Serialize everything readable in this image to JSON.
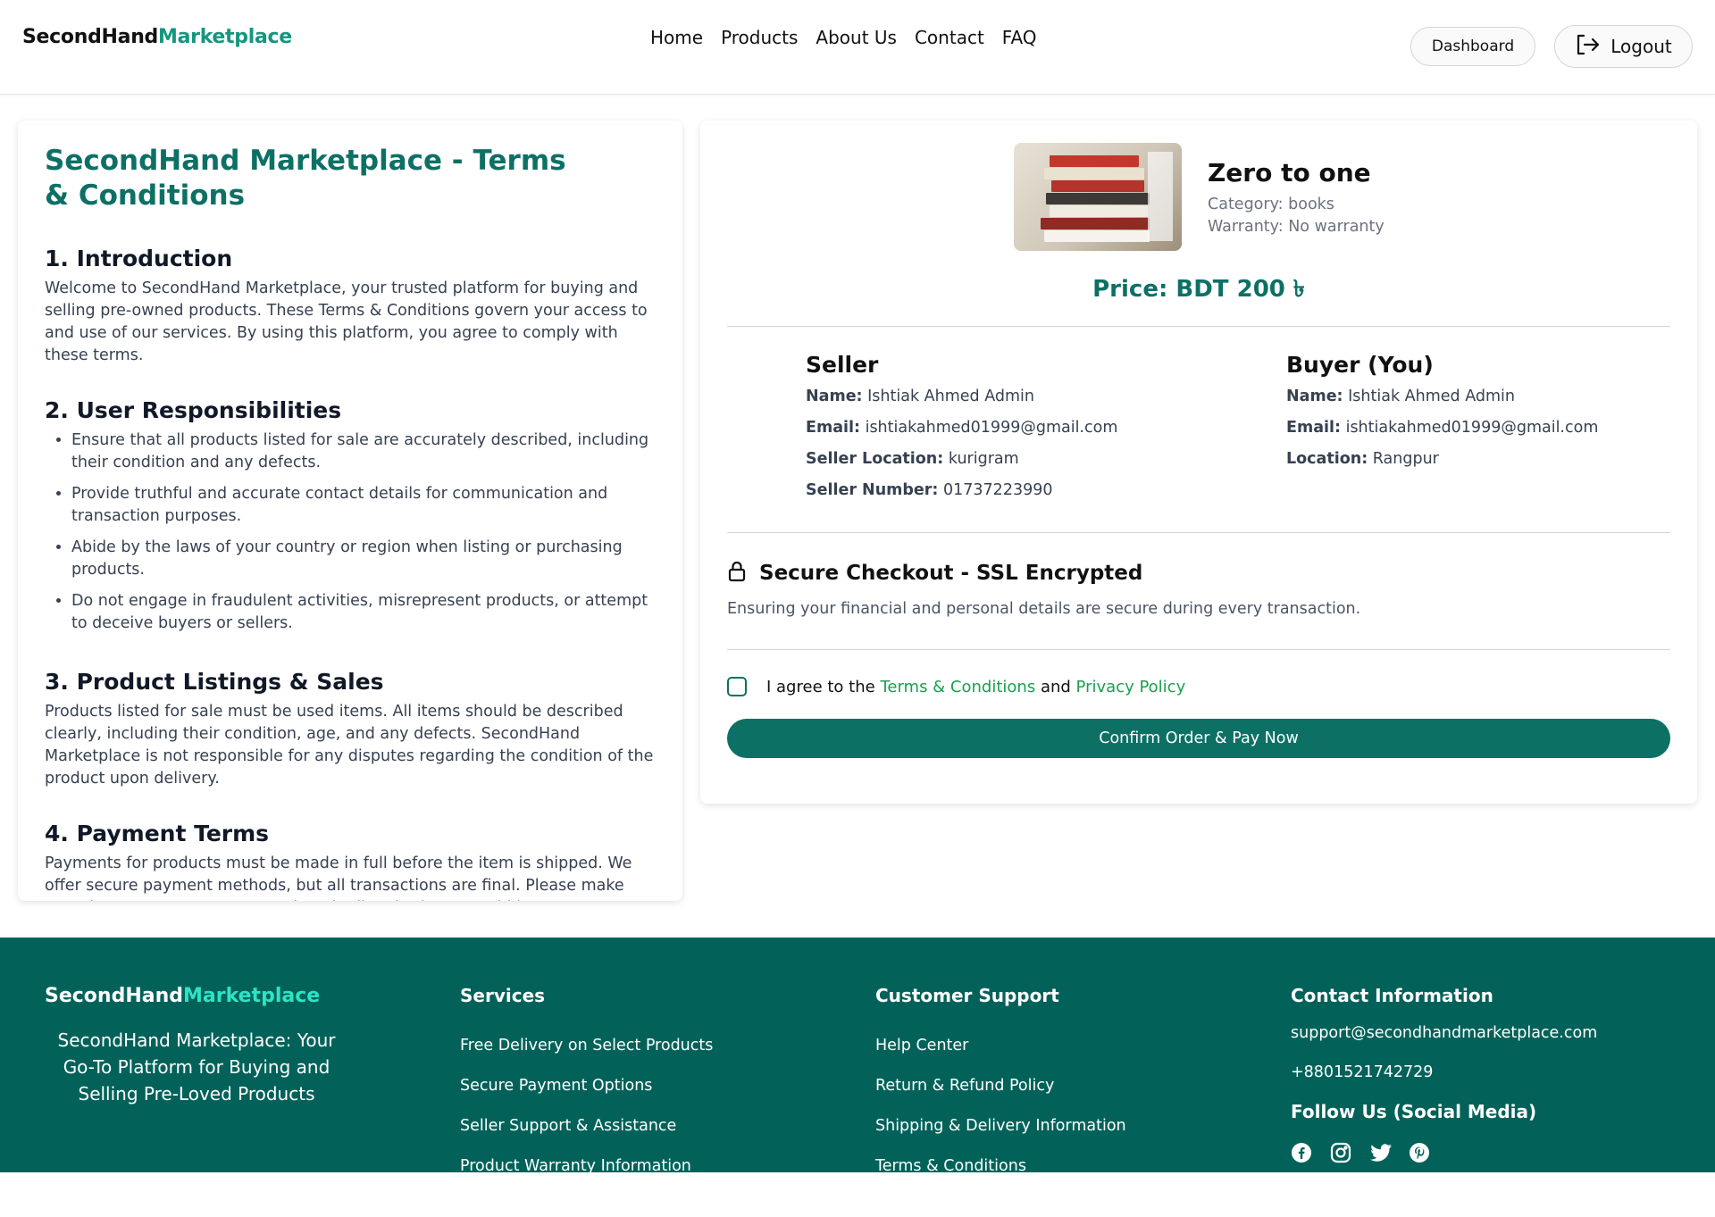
{
  "header": {
    "logo_main": "SecondHand",
    "logo_accent": "Marketplace",
    "nav": [
      "Home",
      "Products",
      "About Us",
      "Contact",
      "FAQ"
    ],
    "dashboard_label": "Dashboard",
    "logout_label": "Logout"
  },
  "terms": {
    "title": "SecondHand Marketplace - Terms & Conditions",
    "sections": [
      {
        "heading": "1. Introduction",
        "body": "Welcome to SecondHand Marketplace, your trusted platform for buying and selling pre-owned products. These Terms & Conditions govern your access to and use of our services. By using this platform, you agree to comply with these terms."
      },
      {
        "heading": "2. User Responsibilities",
        "bullets": [
          "Ensure that all products listed for sale are accurately described, including their condition and any defects.",
          "Provide truthful and accurate contact details for communication and transaction purposes.",
          "Abide by the laws of your country or region when listing or purchasing products.",
          "Do not engage in fraudulent activities, misrepresent products, or attempt to deceive buyers or sellers."
        ]
      },
      {
        "heading": "3. Product Listings & Sales",
        "body": "Products listed for sale must be used items. All items should be described clearly, including their condition, age, and any defects. SecondHand Marketplace is not responsible for any disputes regarding the condition of the product upon delivery."
      },
      {
        "heading": "4. Payment Terms",
        "body": "Payments for products must be made in full before the item is shipped. We offer secure payment methods, but all transactions are final. Please make sure the payment amount matches the listed price to avoid issues."
      }
    ]
  },
  "product": {
    "name": "Zero to one",
    "category": "Category: books",
    "warranty": "Warranty: No warranty",
    "price": "Price: BDT 200 ৳"
  },
  "seller": {
    "heading": "Seller",
    "name_label": "Name:",
    "name": "Ishtiak Ahmed Admin",
    "email_label": "Email:",
    "email": "ishtiakahmed01999@gmail.com",
    "location_label": "Seller Location:",
    "location": "kurigram",
    "number_label": "Seller Number:",
    "number": "01737223990"
  },
  "buyer": {
    "heading": "Buyer (You)",
    "name_label": "Name:",
    "name": "Ishtiak Ahmed Admin",
    "email_label": "Email:",
    "email": "ishtiakahmed01999@gmail.com",
    "location_label": "Location:",
    "location": "Rangpur"
  },
  "secure": {
    "title": "Secure Checkout - SSL Encrypted",
    "desc": "Ensuring your financial and personal details are secure during every transaction."
  },
  "agree": {
    "prefix": "I agree to the",
    "terms_link": "Terms & Conditions",
    "and": "and",
    "privacy_link": "Privacy Policy",
    "checked": false
  },
  "confirm_label": "Confirm Order & Pay Now",
  "footer": {
    "logo_main": "SecondHand",
    "logo_accent": "Marketplace",
    "tagline": "SecondHand Marketplace: Your Go-To Platform for Buying and Selling Pre-Loved Products",
    "services": {
      "heading": "Services",
      "items": [
        "Free Delivery on Select Products",
        "Secure Payment Options",
        "Seller Support & Assistance",
        "Product Warranty Information"
      ]
    },
    "support": {
      "heading": "Customer Support",
      "items": [
        "Help Center",
        "Return & Refund Policy",
        "Shipping & Delivery Information",
        "Terms & Conditions"
      ]
    },
    "contact": {
      "heading": "Contact Information",
      "email": "support@secondhandmarketplace.com",
      "phone": "+8801521742729",
      "follow": "Follow Us (Social Media)",
      "socials": [
        "facebook-icon",
        "instagram-icon",
        "twitter-icon",
        "pinterest-icon"
      ]
    }
  },
  "colors": {
    "brand": "#0d7065",
    "accent": "#14977f",
    "footer_bg": "#02625a",
    "link_green": "#1aa04d"
  }
}
